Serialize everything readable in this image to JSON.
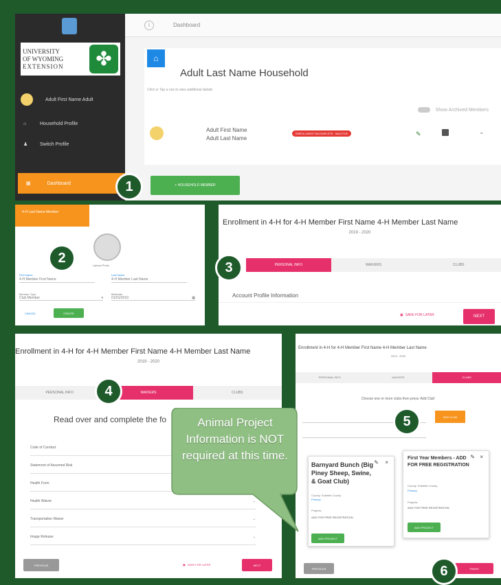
{
  "dashboard": {
    "breadcrumb": "Dashboard",
    "household_title": "Adult Last Name Household",
    "hint": "Click or Tap a row to view additional details",
    "show_archived": "Show Archived Members",
    "member_first": "Adult First Name",
    "member_last": "Adult Last Name",
    "status_badge": "ENROLLMENT INCOMPLETE · INACTIVE",
    "add_member_button": "+ HOUSEHOLD MEMBER"
  },
  "sidebar": {
    "university_line1": "UNIVERSITY",
    "university_line2": "OF WYOMING",
    "extension": "EXTENSION",
    "user_name": "Adult First Name Adult",
    "items": [
      {
        "label": "Household Profile",
        "icon": "home-icon"
      },
      {
        "label": "Switch Profile",
        "icon": "person-icon"
      }
    ],
    "dashboard_label": "Dashboard"
  },
  "step2": {
    "header_btn": "4-H Last Name Member",
    "upload_label": "Upload Photo",
    "first_label": "First Name",
    "first_value": "4-H Member First Name",
    "last_label": "Last Name",
    "last_value": "4-H Member Last Name",
    "role_label": "Member Type",
    "role_value": "Club Member",
    "dob_label": "Birthdate",
    "dob_value": "01/01/2010",
    "cancel": "CANCEL",
    "create": "CREATE"
  },
  "step3": {
    "title": "Enrollment in 4-H for 4-H Member First Name 4-H Member Last Name",
    "year": "2019 - 2020",
    "tabs": [
      "PERSONAL INFO",
      "WAIVERS",
      "CLUBS"
    ],
    "section": "Account Profile Information",
    "save_later": "SAVE FOR LATER",
    "next": "NEXT"
  },
  "step4": {
    "title": "Enrollment in 4-H for 4-H Member First Name 4-H Member Last Name",
    "year": "2019 - 2020",
    "tabs": [
      "PERSONAL INFO",
      "WAIVERS",
      "CLUBS"
    ],
    "instruction": "Read over and complete the fo",
    "rows": [
      "Code of Conduct",
      "Statement of Assumed Risk",
      "Health Form",
      "Health Waiver",
      "Transportation Waiver",
      "Image Release"
    ],
    "previous": "PREVIOUS",
    "save_later": "SAVE FOR LATER",
    "next": "NEXT"
  },
  "step5": {
    "title": "Enrollment in 4-H for 4-H Member First Name 4-H Member Last Name",
    "year": "2019 - 2020",
    "tabs": [
      "PERSONAL INFO",
      "WAIVERS",
      "CLUBS"
    ],
    "instruction": "Choose one or more clubs then press 'Add Club'",
    "add_club": "ADD CLUB",
    "club1_title": "Barnyard Bunch (Big Piney Sheep, Swine, & Goat Club)",
    "club1_county": "County: Sublette County",
    "club1_flag": "Primary",
    "club2_title": "First Year Members - ADD FOR FREE REGISTRATION",
    "club2_county": "County: Sublette County",
    "club2_flag": "Primary",
    "projects_label": "Projects",
    "project_item": "ADD FOR FREE REGISTRATION",
    "add_project": "ADD PROJECT",
    "previous": "PREVIOUS",
    "finish": "FINISH"
  },
  "callout": "Animal Project Information is NOT required at this time.",
  "step_numbers": [
    "1",
    "2",
    "3",
    "4",
    "5",
    "6"
  ],
  "colors": {
    "green": "#1f5a2b",
    "pink": "#e6306b",
    "orange": "#f7941d",
    "button_green": "#4caf50",
    "sidebar": "#2b2b2b"
  }
}
